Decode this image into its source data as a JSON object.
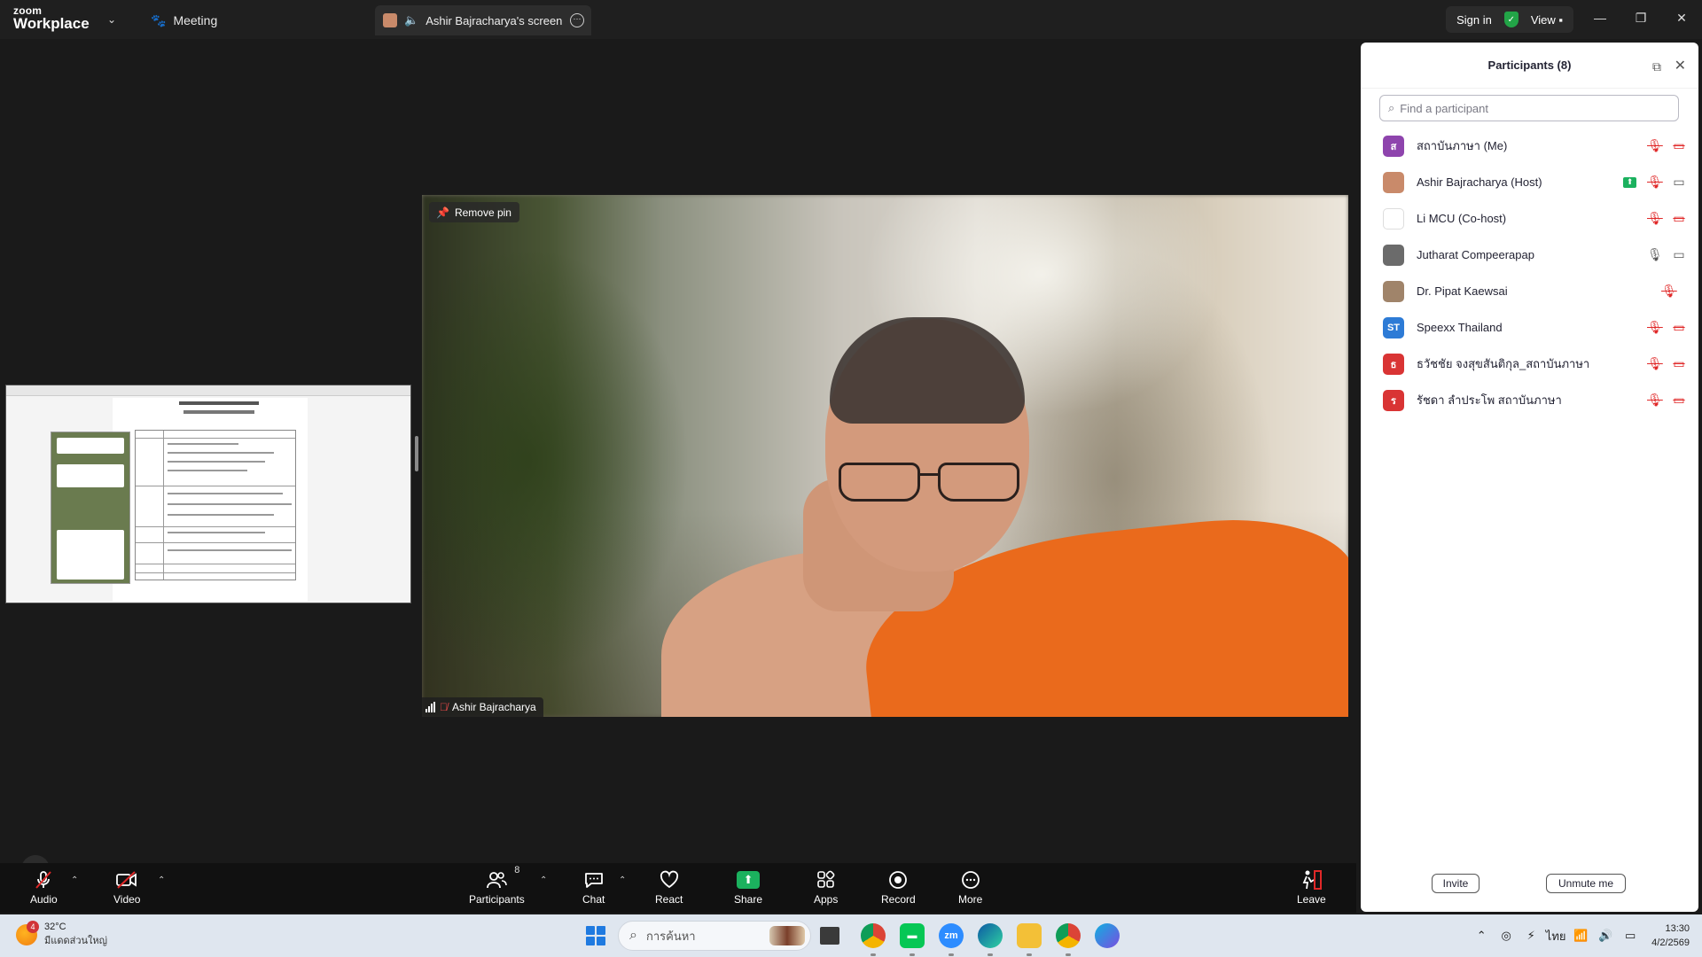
{
  "app": {
    "logo_top": "zoom",
    "logo_bottom": "Workplace"
  },
  "titlebar": {
    "meeting_tab": "Meeting",
    "screen_tab": "Ashir Bajracharya's screen",
    "sign_in": "Sign in",
    "view": "View"
  },
  "stage": {
    "remove_pin": "Remove pin",
    "speaker_name": "Ashir Bajracharya"
  },
  "toolbar": {
    "audio": "Audio",
    "video": "Video",
    "participants": "Participants",
    "participants_count": "8",
    "chat": "Chat",
    "react": "React",
    "share": "Share",
    "apps": "Apps",
    "record": "Record",
    "more": "More",
    "leave": "Leave"
  },
  "panel": {
    "title": "Participants (8)",
    "search_placeholder": "Find a participant",
    "participants": [
      {
        "name": "สถาบันภาษา (Me)",
        "initial": "ส",
        "color": "#8e44ad",
        "mic": "off",
        "cam": "off",
        "sharing": false
      },
      {
        "name": "Ashir Bajracharya (Host)",
        "initial": "",
        "color": "#c98a6a",
        "mic": "off",
        "cam": "on",
        "sharing": true
      },
      {
        "name": "Li MCU (Co-host)",
        "initial": "",
        "color": "#ffffff",
        "mic": "off",
        "cam": "off",
        "sharing": false
      },
      {
        "name": "Jutharat Compeerapap",
        "initial": "",
        "color": "#6b6b6b",
        "mic": "on",
        "cam": "on",
        "sharing": false
      },
      {
        "name": "Dr. Pipat Kaewsai",
        "initial": "",
        "color": "#a0846a",
        "mic": "off",
        "cam": "none",
        "sharing": false
      },
      {
        "name": "Speexx Thailand",
        "initial": "ST",
        "color": "#2d7bd6",
        "mic": "off",
        "cam": "off",
        "sharing": false
      },
      {
        "name": "ธวัชชัย จงสุขสันติกุล_สถาบันภาษา",
        "initial": "ธ",
        "color": "#d93434",
        "mic": "off",
        "cam": "off",
        "sharing": false
      },
      {
        "name": "รัชดา ลำประโพ สถาบันภาษา",
        "initial": "ร",
        "color": "#d93434",
        "mic": "off",
        "cam": "off",
        "sharing": false
      }
    ],
    "invite": "Invite",
    "unmute_me": "Unmute me"
  },
  "taskbar": {
    "temperature": "32°C",
    "weather_desc": "มีแดดส่วนใหญ่",
    "weather_badge": "4",
    "search_placeholder": "การค้นหา",
    "language": "ไทย",
    "time": "13:30",
    "date": "4/2/2569",
    "zoom_app_label": "zm"
  }
}
